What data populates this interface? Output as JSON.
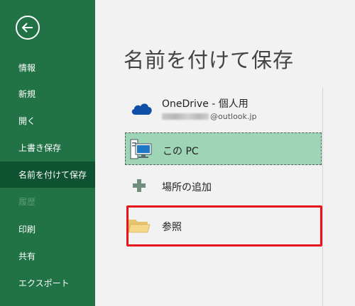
{
  "nav": {
    "items": [
      {
        "label": "情報",
        "state": "normal"
      },
      {
        "label": "新規",
        "state": "normal"
      },
      {
        "label": "開く",
        "state": "normal"
      },
      {
        "label": "上書き保存",
        "state": "normal"
      },
      {
        "label": "名前を付けて保存",
        "state": "active"
      },
      {
        "label": "履歴",
        "state": "disabled"
      },
      {
        "label": "印刷",
        "state": "normal"
      },
      {
        "label": "共有",
        "state": "normal"
      },
      {
        "label": "エクスポート",
        "state": "normal"
      }
    ]
  },
  "page": {
    "title": "名前を付けて保存"
  },
  "locations": {
    "onedrive": {
      "title": "OneDrive - 個人用",
      "account_suffix": "@outlook.jp",
      "icon": "onedrive-cloud-icon"
    },
    "this_pc": {
      "label": "この PC",
      "icon": "computer-icon",
      "selected": true
    },
    "add_place": {
      "label": "場所の追加",
      "icon": "plus-icon"
    },
    "browse": {
      "label": "参照",
      "icon": "folder-icon"
    }
  },
  "colors": {
    "sidebar": "#217346",
    "sidebar_active": "#0f5232",
    "selected_location": "#9fd5b7",
    "highlight": "#e8141c",
    "onedrive_blue": "#0f4fa8"
  }
}
